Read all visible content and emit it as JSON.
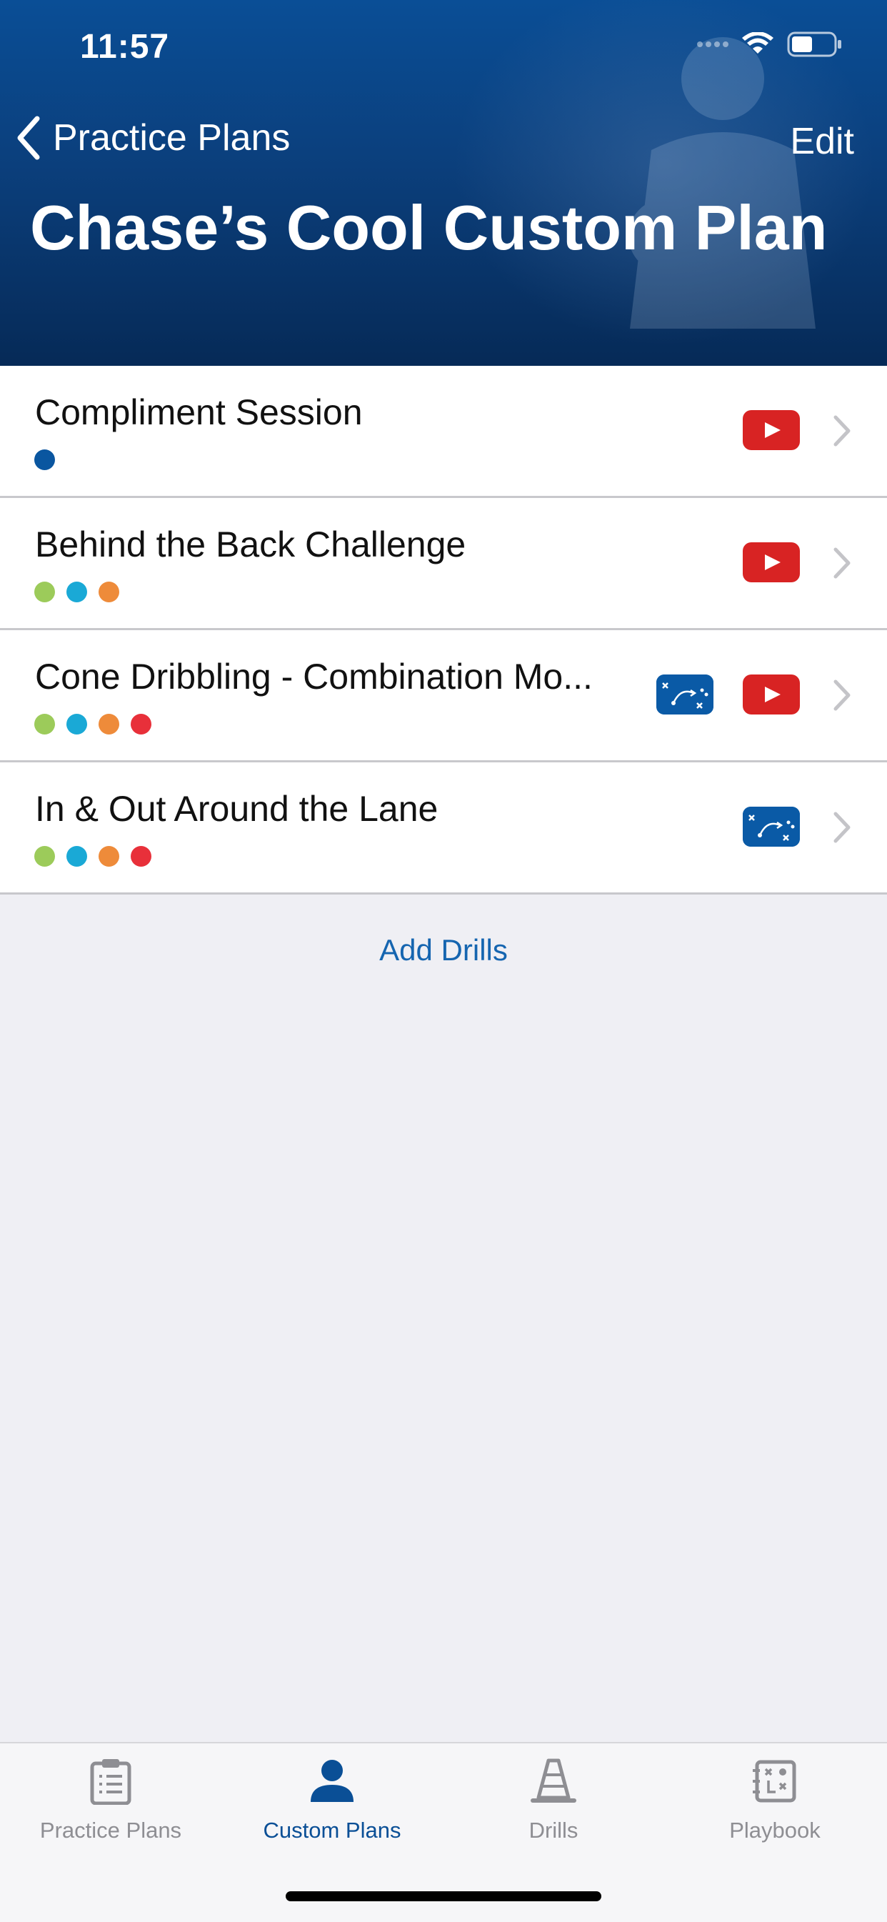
{
  "status_bar": {
    "time": "11:57"
  },
  "nav": {
    "back_label": "Practice Plans",
    "edit_label": "Edit"
  },
  "page_title": "Chase’s Cool Custom Plan",
  "drills": [
    {
      "title": "Compliment Session",
      "dots": [
        "#0a56a0"
      ],
      "has_playbook": false,
      "has_video": true
    },
    {
      "title": "Behind the Back Challenge",
      "dots": [
        "#9ccb5a",
        "#1aa9d6",
        "#ee8b3a"
      ],
      "has_playbook": false,
      "has_video": true
    },
    {
      "title": "Cone Dribbling - Combination Mo...",
      "dots": [
        "#9ccb5a",
        "#1aa9d6",
        "#ee8b3a",
        "#e8303a"
      ],
      "has_playbook": true,
      "has_video": true
    },
    {
      "title": "In & Out Around the Lane",
      "dots": [
        "#9ccb5a",
        "#1aa9d6",
        "#ee8b3a",
        "#e8303a"
      ],
      "has_playbook": true,
      "has_video": false
    }
  ],
  "add_drills_label": "Add Drills",
  "tabs": [
    {
      "label": "Practice Plans",
      "icon": "clipboard-icon",
      "active": false
    },
    {
      "label": "Custom Plans",
      "icon": "person-icon",
      "active": true
    },
    {
      "label": "Drills",
      "icon": "cone-icon",
      "active": false
    },
    {
      "label": "Playbook",
      "icon": "playbook-icon",
      "active": false
    }
  ],
  "colors": {
    "accent": "#0a4f96",
    "video_red": "#d82323",
    "header_blue": "#0b3f7c"
  }
}
